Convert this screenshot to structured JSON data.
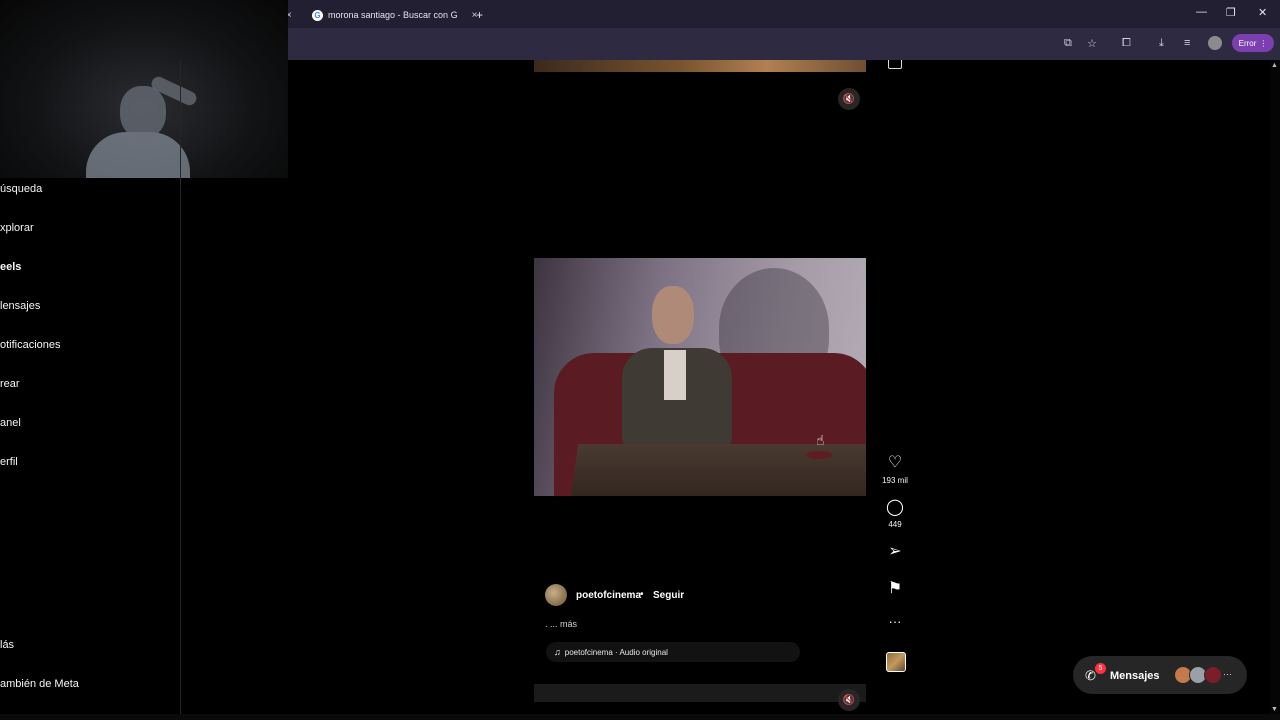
{
  "browser": {
    "tabs": [
      {
        "label": "",
        "close": "×"
      },
      {
        "label": "morona santiago - Buscar con G",
        "close": "×"
      }
    ],
    "new_tab": "+",
    "window_controls": {
      "minimize": "—",
      "restore": "❐",
      "close": "✕"
    },
    "error_label": "Error"
  },
  "sidebar": {
    "items": [
      {
        "label": "úsqueda"
      },
      {
        "label": "xplorar"
      },
      {
        "label": "eels"
      },
      {
        "label": "lensajes"
      },
      {
        "label": "otificaciones"
      },
      {
        "label": "rear"
      },
      {
        "label": "anel"
      },
      {
        "label": "erfil"
      }
    ],
    "bottom": [
      {
        "label": "lás"
      },
      {
        "label": "ambién de Meta"
      }
    ]
  },
  "reel": {
    "likes": "193 mil",
    "comments": "449",
    "username": "poetofcinema",
    "follow_label": "Seguir",
    "dot": "•",
    "caption_more": ". ... más",
    "audio": "poetofcinema · Audio original"
  },
  "messages": {
    "label": "Mensajes",
    "badge": "5"
  },
  "colors": {
    "background": "#000000",
    "browser_tabbar": "#221f33",
    "browser_toolbar": "#2e2a42",
    "error_pill": "#7b3fb0",
    "badge": "#ff3040"
  }
}
